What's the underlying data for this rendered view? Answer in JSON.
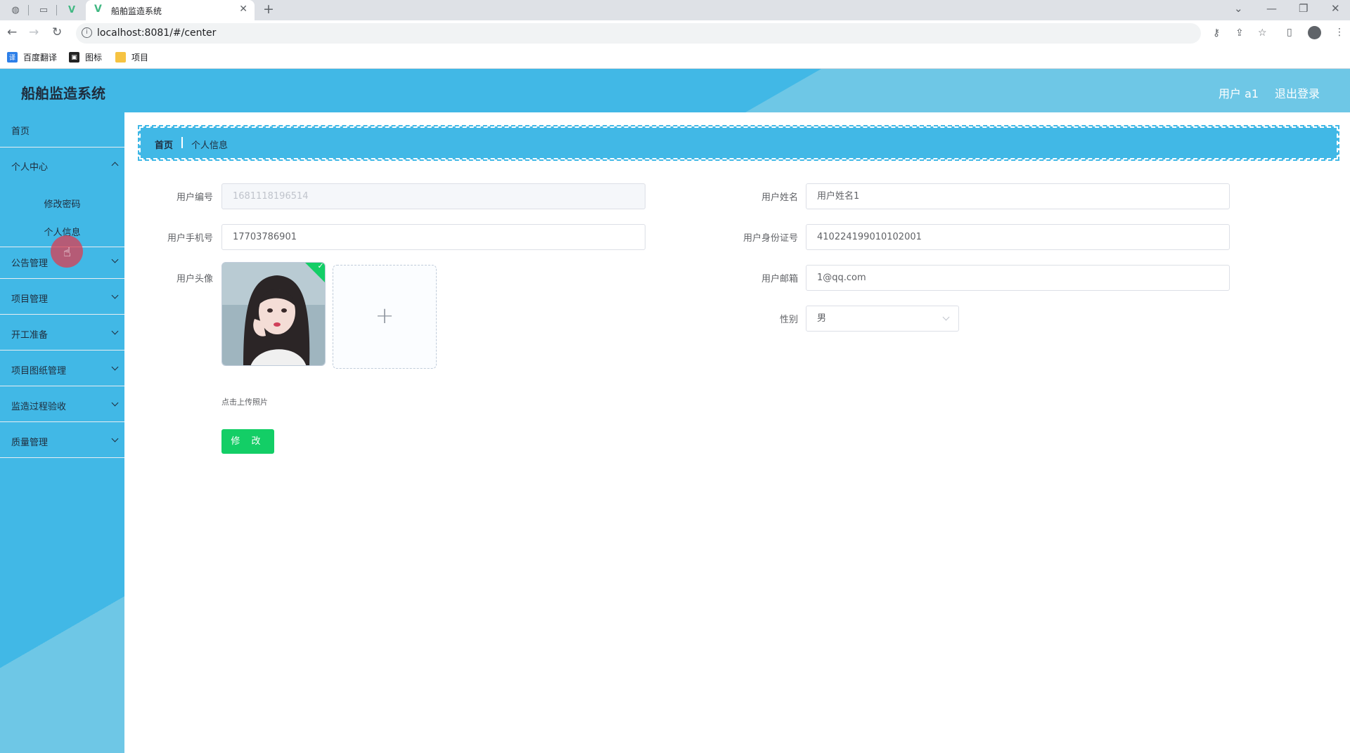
{
  "browser": {
    "tab_title": "船舶监造系统",
    "url": "localhost:8081/#/center",
    "bookmarks": [
      {
        "label": "百度翻译"
      },
      {
        "label": "图标"
      },
      {
        "label": "项目"
      }
    ]
  },
  "header": {
    "title": "船舶监造系统",
    "user": "用户 a1",
    "logout": "退出登录"
  },
  "sidebar": {
    "items": [
      {
        "label": "首页"
      },
      {
        "label": "个人中心",
        "children": [
          "修改密码",
          "个人信息"
        ]
      },
      {
        "label": "公告管理"
      },
      {
        "label": "项目管理"
      },
      {
        "label": "开工准备"
      },
      {
        "label": "项目图纸管理"
      },
      {
        "label": "监造过程验收"
      },
      {
        "label": "质量管理"
      }
    ]
  },
  "breadcrumb": {
    "home": "首页",
    "current": "个人信息"
  },
  "form": {
    "user_no": {
      "label": "用户编号",
      "value": "1681118196514"
    },
    "user_name": {
      "label": "用户姓名",
      "value": "用户姓名1"
    },
    "phone": {
      "label": "用户手机号",
      "value": "17703786901"
    },
    "id_card": {
      "label": "用户身份证号",
      "value": "410224199010102001"
    },
    "avatar": {
      "label": "用户头像",
      "upload_tip": "点击上传照片"
    },
    "email": {
      "label": "用户邮箱",
      "value": "1@qq.com"
    },
    "gender": {
      "label": "性别",
      "value": "男"
    },
    "submit": "修 改"
  },
  "colors": {
    "primary": "#41b8e6",
    "success": "#13ce66"
  }
}
